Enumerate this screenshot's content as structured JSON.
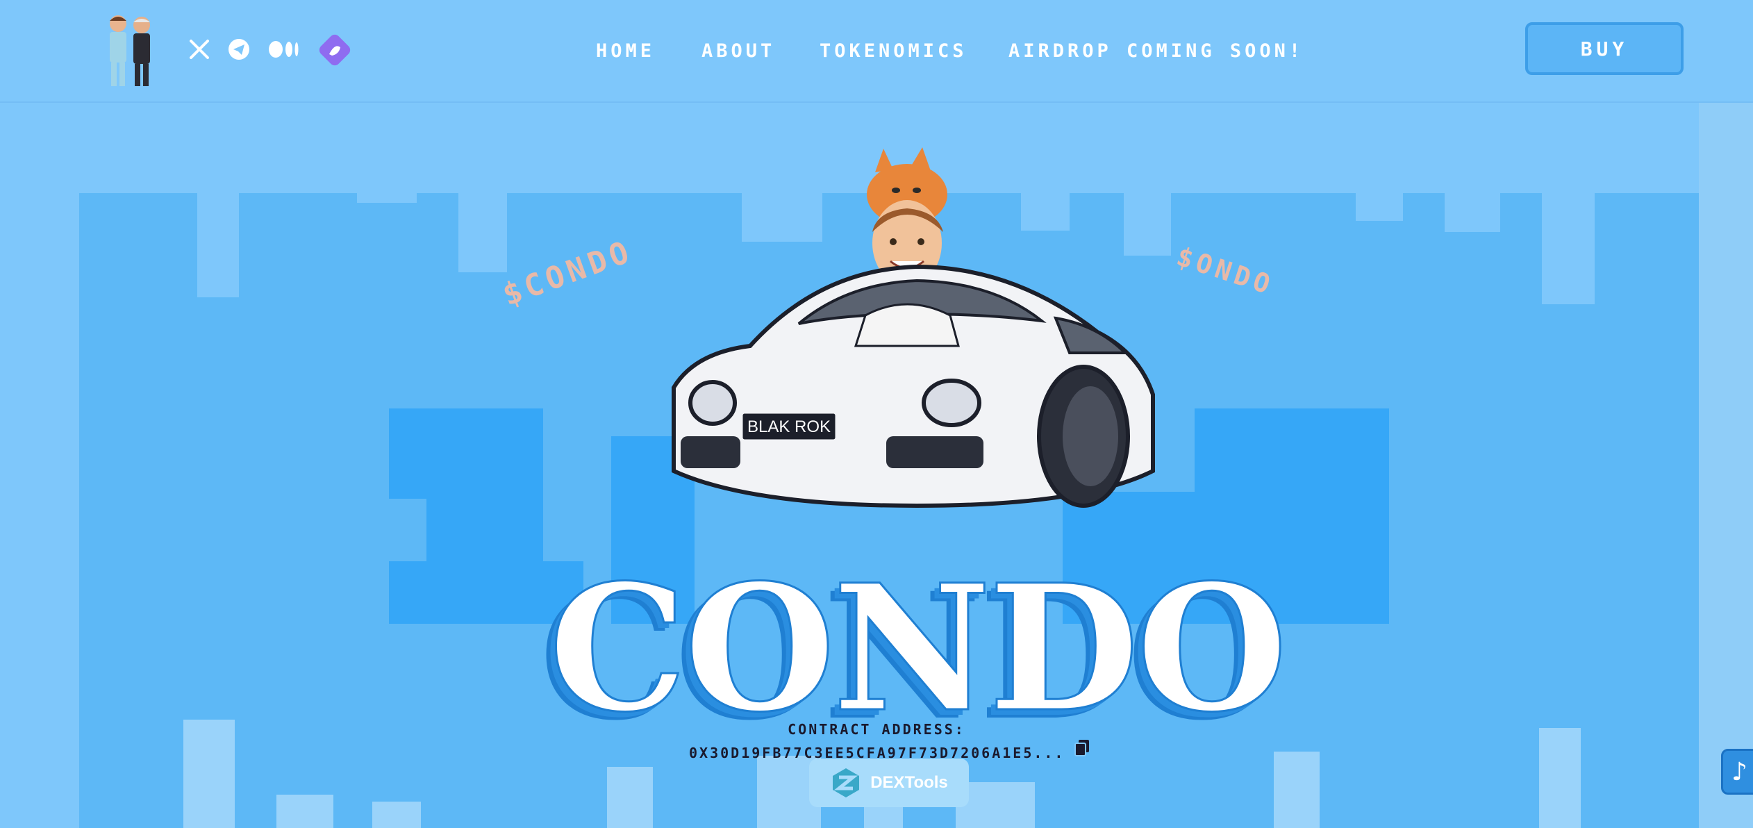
{
  "header": {
    "nav": [
      "HOME",
      "ABOUT",
      "TOKENOMICS",
      "AIRDROP COMING SOON!"
    ],
    "buy_label": "BUY",
    "social_icons": [
      "x-icon",
      "telegram-icon",
      "medium-icon",
      "phantom-icon"
    ]
  },
  "hero": {
    "tag_left": "$CONDO",
    "tag_right": "$ONDO",
    "title": "CONDO",
    "plate": "BLAK ROK",
    "dextools_label": "DEXTools",
    "contract_label": "CONTRACT ADDRESS:",
    "contract_value": "0X30D19FB77C3EE5CFA97F73D7206A1E5..."
  },
  "colors": {
    "background": "#7ec7fb",
    "sky_dark": "#5db8f6",
    "buildings_deep": "#36a7f7",
    "title_shadow": "#1f7fd2",
    "tag_color": "#e8b9a8"
  }
}
